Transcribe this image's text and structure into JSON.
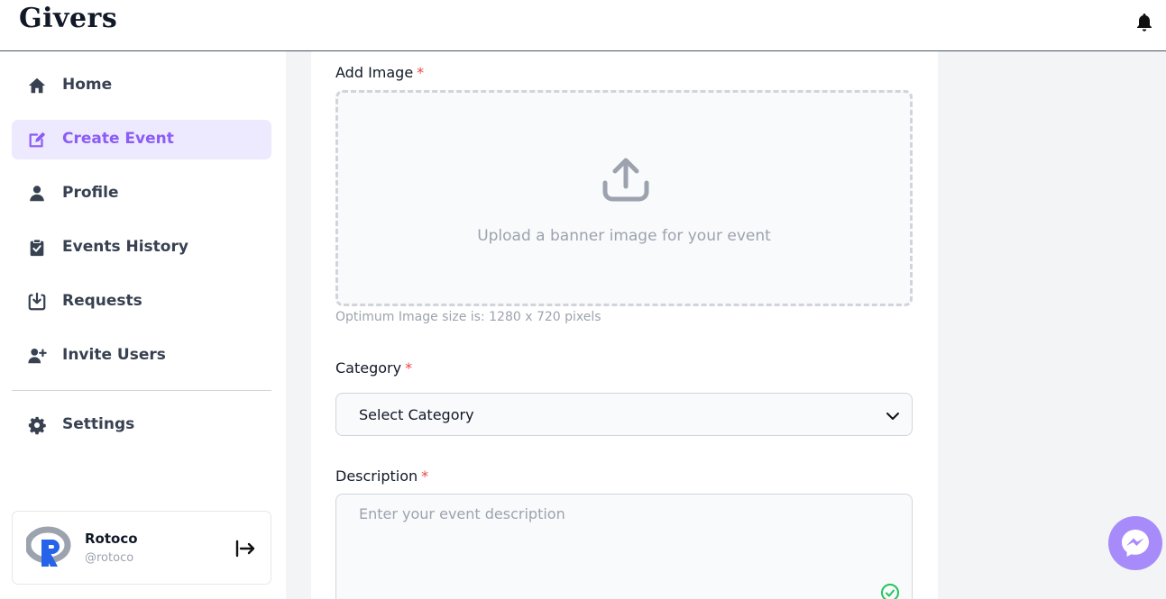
{
  "app": {
    "brand": "Givers"
  },
  "sidebar": {
    "items": [
      {
        "label": "Home",
        "icon": "home-icon"
      },
      {
        "label": "Create Event",
        "icon": "edit-icon",
        "active": true
      },
      {
        "label": "Profile",
        "icon": "user-icon"
      },
      {
        "label": "Events History",
        "icon": "clipboard-check-icon"
      },
      {
        "label": "Requests",
        "icon": "download-box-icon"
      },
      {
        "label": "Invite Users",
        "icon": "user-plus-icon"
      }
    ],
    "settings": {
      "label": "Settings",
      "icon": "gear-icon"
    }
  },
  "user": {
    "name": "Rotoco",
    "handle": "@rotoco"
  },
  "form": {
    "image": {
      "label": "Add Image",
      "required_mark": "*",
      "upload_text": "Upload a banner image for your event",
      "hint": "Optimum Image size is: 1280 x 720 pixels"
    },
    "category": {
      "label": "Category",
      "required_mark": "*",
      "value": "Select Category"
    },
    "description": {
      "label": "Description",
      "required_mark": "*",
      "placeholder": "Enter your event description"
    }
  },
  "colors": {
    "accent": "#8b5cf6",
    "accent_bg": "#ede9fe",
    "required": "#ef4444",
    "messenger": "#a78bfa"
  }
}
